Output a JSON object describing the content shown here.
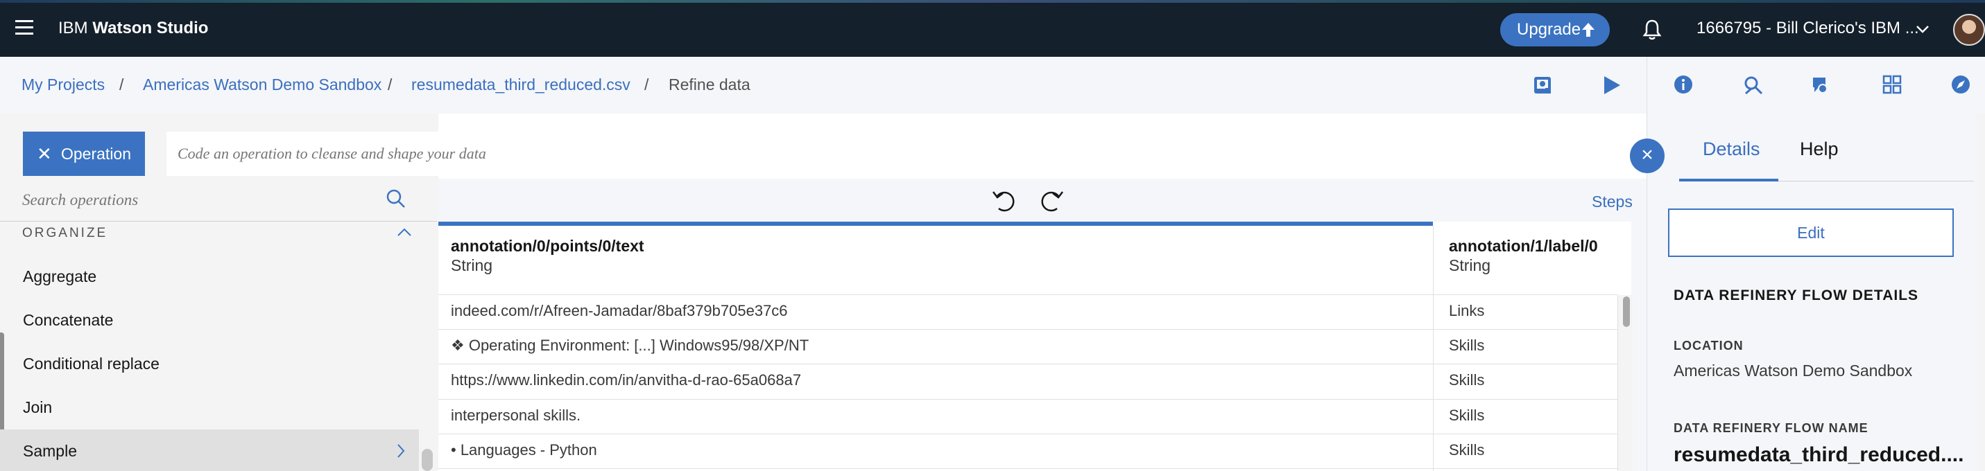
{
  "app": {
    "brand_regular": "IBM ",
    "brand_bold": "Watson Studio",
    "upgrade_label": "Upgrade",
    "account_label": "1666795 - Bill Clerico's IBM ...",
    "accent": "#3b73c2",
    "topbar_bg": "#14202b"
  },
  "breadcrumb": {
    "items": [
      "My Projects",
      "Americas Watson Demo Sandbox",
      "resumedata_third_reduced.csv",
      "Refine data"
    ],
    "separator": "/"
  },
  "toolbar": {
    "icons": [
      "schedule-icon",
      "run-icon"
    ]
  },
  "right_icons": [
    "info-icon",
    "compare-icon",
    "feedback-icon",
    "grid-icon",
    "explore-icon"
  ],
  "operation": {
    "button_label": "Operation",
    "code_placeholder": "Code an operation to cleanse and shape your data"
  },
  "search": {
    "placeholder": "Search operations"
  },
  "operations": {
    "section": "ORGANIZE",
    "items": [
      "Aggregate",
      "Concatenate",
      "Conditional replace",
      "Join",
      "Sample"
    ]
  },
  "grid": {
    "steps_label": "Steps",
    "columns": [
      {
        "name": "annotation/0/points/0/text",
        "type": "String"
      },
      {
        "name": "annotation/1/label/0",
        "type": "String"
      }
    ],
    "rows": [
      [
        "indeed.com/r/Afreen-Jamadar/8baf379b705e37c6",
        "Links"
      ],
      [
        "❖ Operating Environment: [...] Windows95/98/XP/NT",
        "Skills"
      ],
      [
        "https://www.linkedin.com/in/anvitha-d-rao-65a068a7",
        "Skills"
      ],
      [
        "interpersonal skills.",
        "Skills"
      ],
      [
        "• Languages - Python",
        "Skills"
      ]
    ]
  },
  "details": {
    "tabs": [
      "Details",
      "Help"
    ],
    "edit_label": "Edit",
    "heading": "DATA REFINERY FLOW DETAILS",
    "location_label": "LOCATION",
    "location_value": "Americas Watson Demo Sandbox",
    "flow_name_label": "DATA REFINERY FLOW NAME",
    "flow_name_value": "resumedata_third_reduced...."
  }
}
